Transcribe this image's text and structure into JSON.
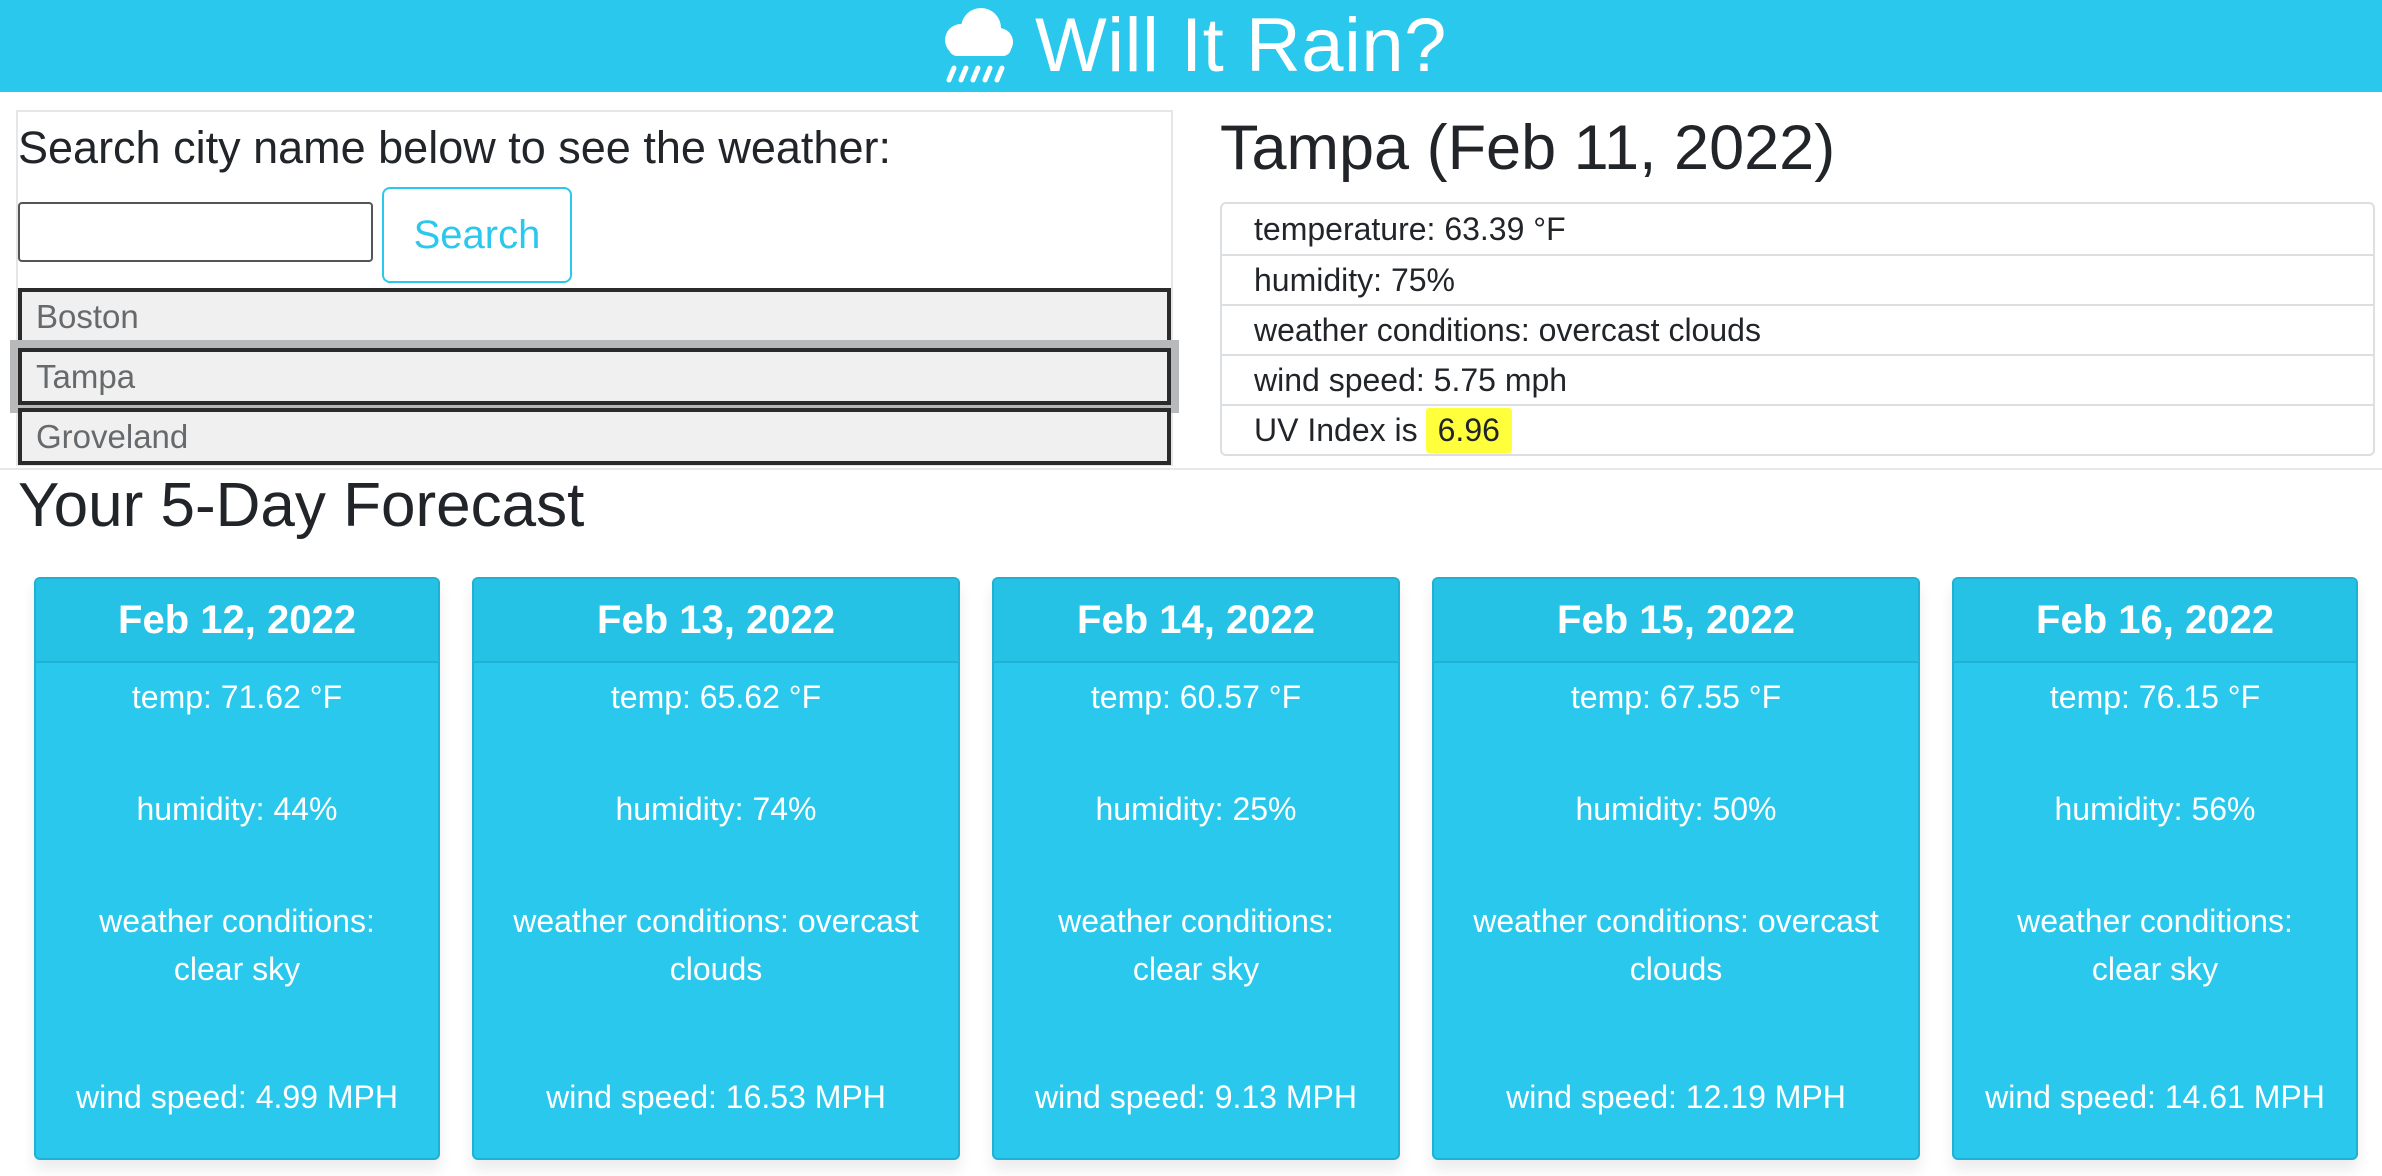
{
  "header": {
    "title": "Will It Rain?",
    "icon": "cloud-rain-icon",
    "background_color": "#29c8ec"
  },
  "search": {
    "heading": "Search city name below to see the weather:",
    "input_value": "",
    "button_label": "Search",
    "history": [
      {
        "label": "Boston"
      },
      {
        "label": "Tampa"
      },
      {
        "label": "Groveland"
      }
    ]
  },
  "current": {
    "title": "Tampa (Feb 11, 2022)",
    "temperature": "temperature: 63.39 °F",
    "humidity": "humidity: 75%",
    "conditions": "weather conditions: overcast clouds",
    "wind": "wind speed: 5.75 mph",
    "uv_label": "UV Index is",
    "uv_value": "6.96",
    "uv_color": "#ffff3b"
  },
  "forecast": {
    "heading": "Your 5-Day Forecast",
    "days": [
      {
        "date": "Feb 12, 2022",
        "temp": "temp: 71.62 °F",
        "humidity": "humidity: 44%",
        "conditions_1": "weather conditions:",
        "conditions_2": "clear sky",
        "wind": "wind speed: 4.99 MPH"
      },
      {
        "date": "Feb 13, 2022",
        "temp": "temp: 65.62 °F",
        "humidity": "humidity: 74%",
        "conditions_1": "weather conditions: overcast",
        "conditions_2": "clouds",
        "wind": "wind speed: 16.53 MPH"
      },
      {
        "date": "Feb 14, 2022",
        "temp": "temp: 60.57 °F",
        "humidity": "humidity: 25%",
        "conditions_1": "weather conditions:",
        "conditions_2": "clear sky",
        "wind": "wind speed: 9.13 MPH"
      },
      {
        "date": "Feb 15, 2022",
        "temp": "temp: 67.55 °F",
        "humidity": "humidity: 50%",
        "conditions_1": "weather conditions: overcast",
        "conditions_2": "clouds",
        "wind": "wind speed: 12.19 MPH"
      },
      {
        "date": "Feb 16, 2022",
        "temp": "temp: 76.15 °F",
        "humidity": "humidity: 56%",
        "conditions_1": "weather conditions:",
        "conditions_2": "clear sky",
        "wind": "wind speed: 14.61 MPH"
      }
    ]
  }
}
